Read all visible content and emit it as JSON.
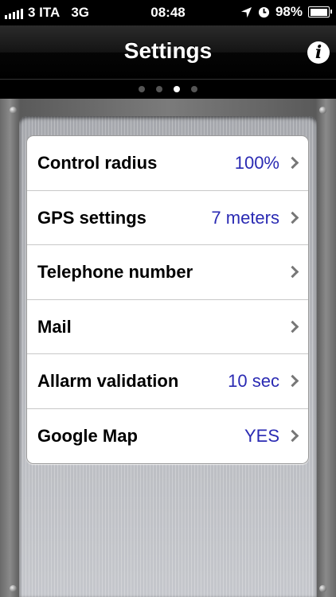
{
  "status_bar": {
    "carrier": "3 ITA",
    "network": "3G",
    "time": "08:48",
    "battery": "98%",
    "battery_level": 0.98
  },
  "nav": {
    "title": "Settings",
    "info_icon": "info-icon",
    "info_glyph": "i"
  },
  "page_control": {
    "pages": 4,
    "current": 3
  },
  "settings": {
    "rows": [
      {
        "label": "Control radius",
        "value": "100%"
      },
      {
        "label": "GPS settings",
        "value": "7 meters"
      },
      {
        "label": "Telephone number",
        "value": ""
      },
      {
        "label": "Mail",
        "value": ""
      },
      {
        "label": "Allarm validation",
        "value": "10 sec"
      },
      {
        "label": "Google Map",
        "value": "YES"
      }
    ]
  },
  "colors": {
    "value_text": "#2a2ab3",
    "nav_background": "#000000"
  }
}
